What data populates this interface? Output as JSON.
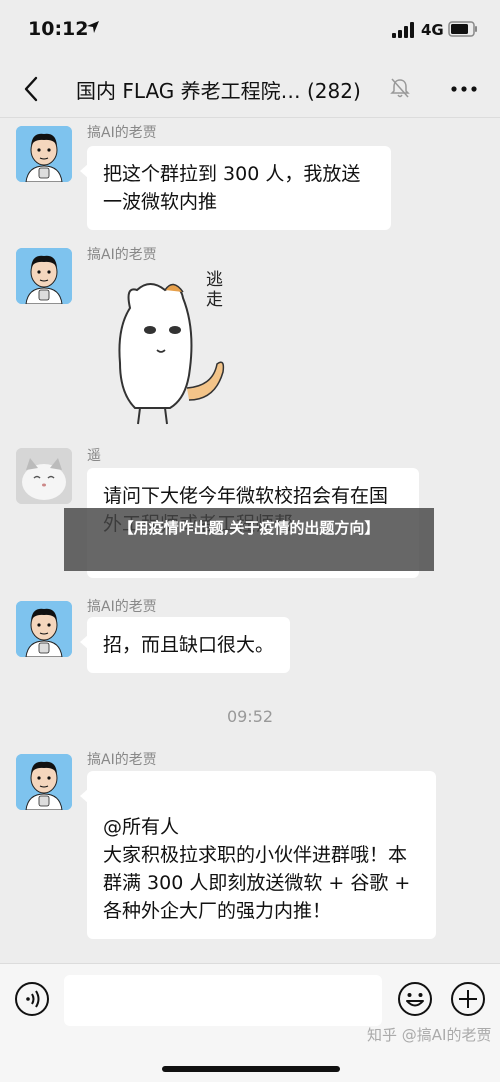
{
  "status": {
    "time": "10:12",
    "network": "4G"
  },
  "nav": {
    "title": "国内 FLAG 养老工程院… (282)"
  },
  "messages": [
    {
      "sender": "搞AI的老贾",
      "text": "把这个群拉到 300 人，我放送一波微软内推"
    },
    {
      "sender": "搞AI的老贾",
      "sticker_text": "逃走"
    },
    {
      "sender": "遥",
      "text": "请问下大佬今年微软校招会有在国外工程师或者工程师帮"
    },
    {
      "sender": "搞AI的老贾",
      "text": "招，而且缺口很大。"
    },
    {
      "sender": "搞AI的老贾",
      "text": "@所有人\n大家积极拉求职的小伙伴进群哦！本群满 300 人即刻放送微软 + 谷歌 + 各种外企大厂的强力内推！"
    }
  ],
  "timestamp": "09:52",
  "banner": {
    "text": "【用疫情咋出题,关于疫情的出题方向】"
  },
  "input": {
    "placeholder": ""
  },
  "watermark": "知乎 @搞AI的老贾",
  "colors": {
    "background": "#ededed",
    "bubble": "#ffffff",
    "avatar_bg": "#7ec3ee"
  }
}
